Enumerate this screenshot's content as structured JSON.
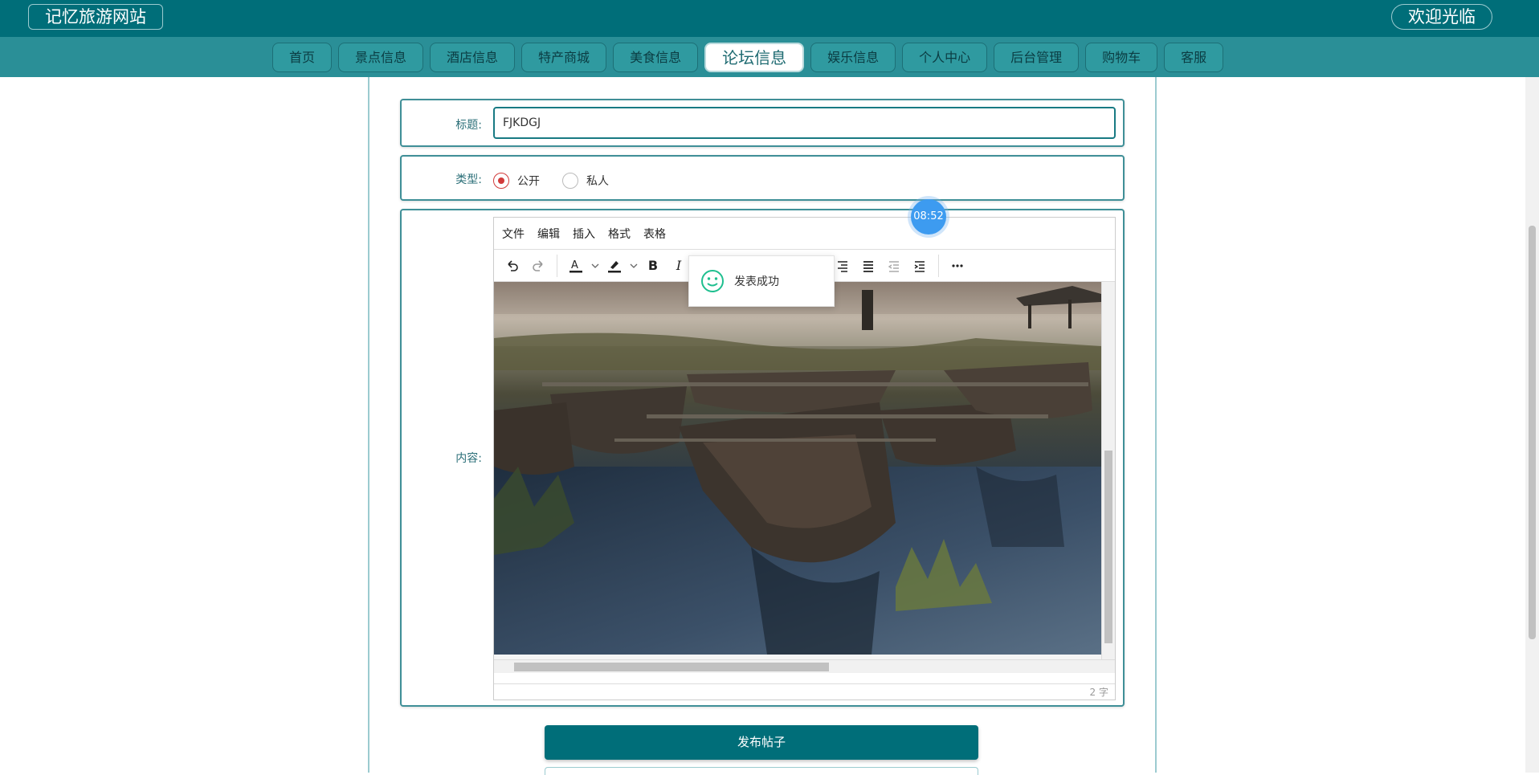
{
  "header": {
    "brand": "记忆旅游网站",
    "welcome": "欢迎光临"
  },
  "nav": {
    "items": [
      {
        "label": "首页",
        "active": false
      },
      {
        "label": "景点信息",
        "active": false
      },
      {
        "label": "酒店信息",
        "active": false
      },
      {
        "label": "特产商城",
        "active": false
      },
      {
        "label": "美食信息",
        "active": false
      },
      {
        "label": "论坛信息",
        "active": true
      },
      {
        "label": "娱乐信息",
        "active": false
      },
      {
        "label": "个人中心",
        "active": false
      },
      {
        "label": "后台管理",
        "active": false
      },
      {
        "label": "购物车",
        "active": false
      },
      {
        "label": "客服",
        "active": false
      }
    ]
  },
  "form": {
    "title_label": "标题:",
    "title_value": "FJKDGJ",
    "type_label": "类型:",
    "type_options": [
      {
        "label": "公开",
        "checked": true
      },
      {
        "label": "私人",
        "checked": false
      }
    ],
    "content_label": "内容:",
    "submit_label": "发布帖子"
  },
  "editor": {
    "menus": [
      "文件",
      "编辑",
      "插入",
      "格式",
      "表格"
    ],
    "toolbar_icons": [
      "undo-icon",
      "redo-icon",
      "font-color-icon",
      "highlight-icon",
      "bold-icon",
      "italic-icon",
      "align-right-icon",
      "justify-icon",
      "outdent-icon",
      "indent-icon",
      "more-icon"
    ],
    "bold_glyph": "B",
    "italic_glyph": "I",
    "word_count": "2 字"
  },
  "toast": {
    "message": "发表成功"
  },
  "timer": {
    "text": "08:52"
  },
  "colors": {
    "header_bg": "#006e79",
    "nav_bg": "#2a8f97",
    "radio_checked": "#d13a3a",
    "toast_icon": "#1fbf8f",
    "timer_bg": "#3d9bf0"
  }
}
